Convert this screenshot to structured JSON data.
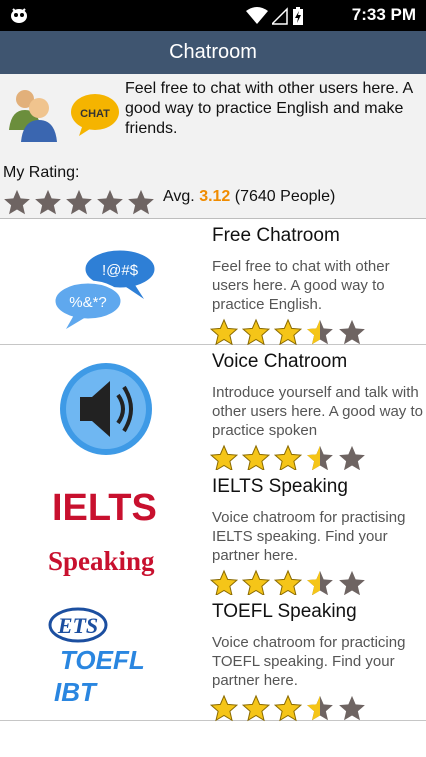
{
  "status_bar": {
    "time": "7:33 PM",
    "battery_icon": "battery-charging-icon",
    "signal_icon": "cell-signal-icon",
    "wifi_icon": "wifi-icon"
  },
  "title": "Chatroom",
  "header": {
    "description": "Feel free to chat with other users here. A good way to practice English and make friends.",
    "icon_badge": "CHAT",
    "my_rating_label": "My Rating:",
    "avg_label": "Avg.",
    "avg_value": "3.12",
    "people": "(7640 People)"
  },
  "rooms": [
    {
      "title": "Free Chatroom",
      "description": "Feel free to chat with other users here. A good way to practice English.",
      "icon": "chat-bubbles-icon",
      "rating": 3.5,
      "bubble1": "!@#$",
      "bubble2": "%&*?"
    },
    {
      "title": "Voice Chatroom",
      "description": "Introduce yourself and talk with other users here. A good way to practice spoken",
      "icon": "speaker-icon",
      "rating": 3.5
    },
    {
      "title": "IELTS Speaking",
      "description": "Voice chatroom for practising IELTS speaking. Find your partner here.",
      "icon": "ielts-logo",
      "rating": 3.5,
      "logo_line1": "IELTS",
      "logo_line2": "Speaking"
    },
    {
      "title": "TOEFL Speaking",
      "description": "Voice chatroom for practicing TOEFL speaking. Find your partner here.",
      "icon": "ets-toefl-logo",
      "rating": 3.5,
      "logo_line1": "ETS",
      "logo_line2": "TOEFL",
      "logo_line3": "IBT"
    }
  ],
  "colors": {
    "title_bar": "#3f5570",
    "star_gold": "#f5c518",
    "star_gray": "#6e6462",
    "avg_orange": "#f08c00"
  }
}
